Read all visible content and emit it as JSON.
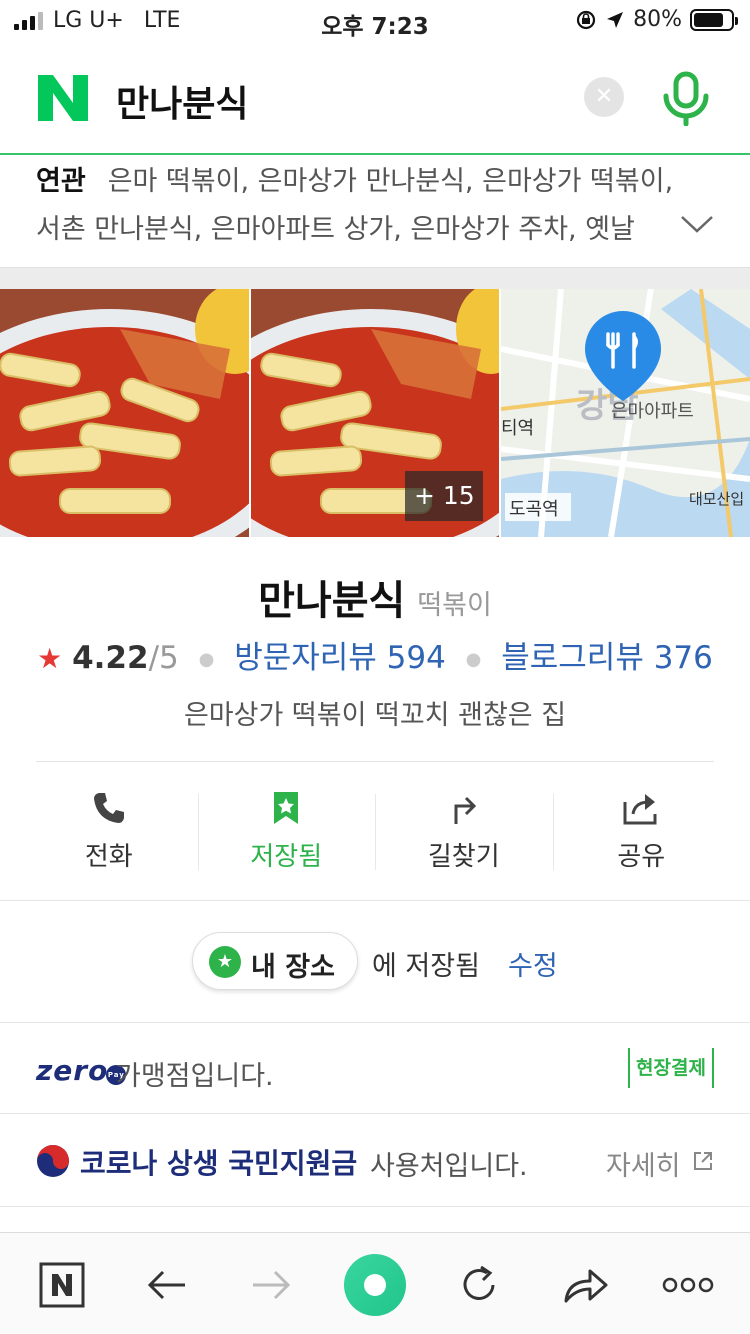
{
  "status_bar": {
    "carrier": "LG U+",
    "network": "LTE",
    "time": "오후 7:23",
    "battery": "80%",
    "battery_level": 0.8
  },
  "search": {
    "query": "만나분식",
    "clear_icon": "close-icon",
    "mic_icon": "microphone-icon"
  },
  "related": {
    "label": "연관",
    "line1": "은마 떡볶이, 은마상가 만나분식, 은마상가 떡볶이,",
    "line2": "서촌 만나분식, 은마아파트 상가, 은마상가 주차, 옛날"
  },
  "photos": {
    "more_count": "+ 15",
    "map_labels": {
      "district": "강남",
      "apartment": "은마아파트",
      "station_left": "티역",
      "station": "도곡역",
      "station_right": "대모산입"
    }
  },
  "place": {
    "name": "만나분식",
    "category": "떡볶이",
    "rating": "4.22",
    "rating_max": "/5",
    "visitor_reviews": "방문자리뷰 594",
    "blog_reviews": "블로그리뷰 376",
    "description": "은마상가 떡볶이 떡꼬치 괜찮은 집"
  },
  "actions": [
    {
      "label": "전화",
      "icon": "phone-icon"
    },
    {
      "label": "저장됨",
      "icon": "bookmark-star-icon"
    },
    {
      "label": "길찾기",
      "icon": "directions-icon"
    },
    {
      "label": "공유",
      "icon": "share-icon"
    }
  ],
  "my_place": {
    "chip_label": "내 장소",
    "saved_text": "에 저장됨",
    "edit_label": "수정"
  },
  "zero_pay": {
    "logo": "zero",
    "logo_sub": "Pay",
    "text": "가맹점입니다.",
    "badge": "현장결제"
  },
  "corona": {
    "title": "코로나 상생 국민지원금",
    "text": "사용처입니다.",
    "detail": "자세히"
  },
  "colors": {
    "naver_green": "#03c75a",
    "saved_green": "#2db34a",
    "link_blue": "#2e64b3",
    "star_red": "#e53935",
    "navy": "#1d2d7a"
  }
}
